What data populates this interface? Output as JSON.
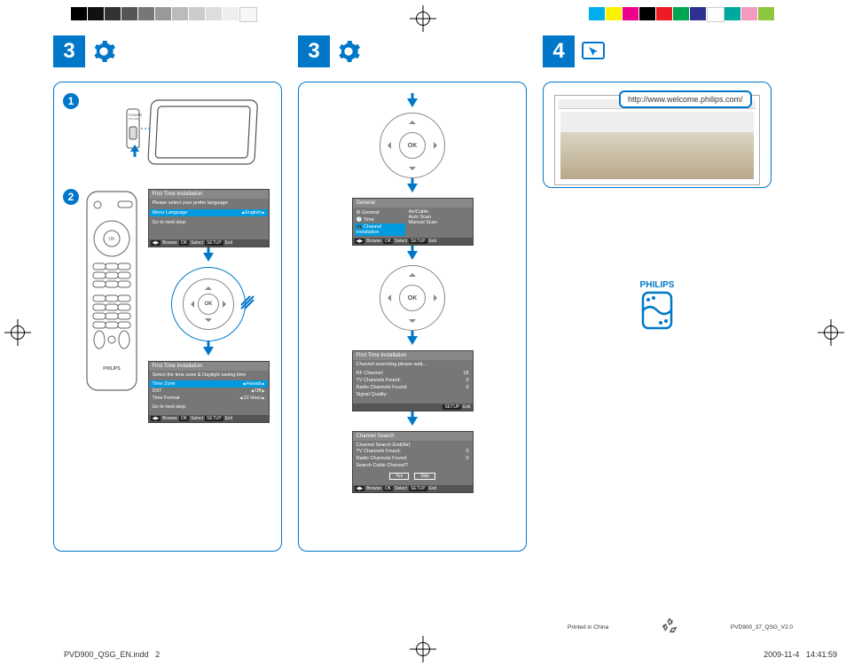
{
  "steps": {
    "col1_num": "3",
    "col2_num": "3",
    "col3_num": "4"
  },
  "col1": {
    "sub1": "1",
    "sub2": "2",
    "power_label": "POWER",
    "power_sub": "ON/OFF",
    "remote_brand": "PHILIPS",
    "osd1": {
      "title": "First Time Installation",
      "prompt": "Please select your prefer language:",
      "row_label": "Menu Language",
      "row_value": "English",
      "next": "Go to next step:",
      "footer_browse_key": "◀▶",
      "footer_browse": "Browse",
      "footer_ok_key": "OK",
      "footer_ok": "Select",
      "footer_setup_key": "SETUP",
      "footer_setup": "Exit"
    },
    "pad_ok": "OK",
    "osd2": {
      "title": "First Time Installation",
      "prompt": "Select the time zone & Daylight saving time",
      "rows": [
        {
          "l": "Time Zone",
          "r": "Hawaii"
        },
        {
          "l": "DST",
          "r": "Off"
        },
        {
          "l": "Time Format",
          "r": "12 Hour"
        }
      ],
      "next": "Go to next step:",
      "footer_browse_key": "◀▶",
      "footer_browse": "Browse",
      "footer_ok_key": "OK",
      "footer_ok": "Select",
      "footer_setup_key": "SETUP",
      "footer_setup": "Exit"
    }
  },
  "col2": {
    "pad_ok": "OK",
    "osd_menu": {
      "title": "General",
      "left": [
        "General",
        "Time",
        "Channel installation"
      ],
      "right": [
        "Air/Cable",
        "Auto Scan",
        "Manual Scan"
      ],
      "footer_browse_key": "◀▶",
      "footer_browse": "Browse",
      "footer_ok_key": "OK",
      "footer_ok": "Select",
      "footer_setup_key": "SETUP",
      "footer_setup": "Exit"
    },
    "osd_scan": {
      "title": "First Time Installation",
      "line1": "Channel searching please wait...",
      "rows": [
        {
          "l": "RF Channel:",
          "r": "18"
        },
        {
          "l": "TV Channels Found:",
          "r": "0"
        },
        {
          "l": "Radio Channels Found:",
          "r": "0"
        },
        {
          "l": "Signal Quality:",
          "r": ""
        }
      ],
      "footer_setup_key": "SETUP",
      "footer_setup": "Exit"
    },
    "osd_end": {
      "title": "Channel Search",
      "line1": "Channel Search End(Air)",
      "rows": [
        {
          "l": "TV Channels Found:",
          "r": "0"
        },
        {
          "l": "Radio Channels Found:",
          "r": "0"
        },
        {
          "l": "Search Cable Channel?",
          "r": ""
        }
      ],
      "btn_yes": "Yes",
      "btn_skip": "Skip",
      "footer_browse_key": "◀▶",
      "footer_browse": "Browse",
      "footer_ok_key": "OK",
      "footer_ok": "Select",
      "footer_setup_key": "SETUP",
      "footer_setup": "Exit"
    }
  },
  "col3": {
    "url": "http://www.welcome.philips.com/",
    "logo_text": "PHILIPS"
  },
  "footer": {
    "printed": "Printed in China",
    "doc_id": "PVD900_37_QSG_V2.0"
  },
  "imprint": {
    "file": "PVD900_QSG_EN.indd",
    "page": "2",
    "date": "2009-11-4",
    "time": "14:41:59"
  }
}
